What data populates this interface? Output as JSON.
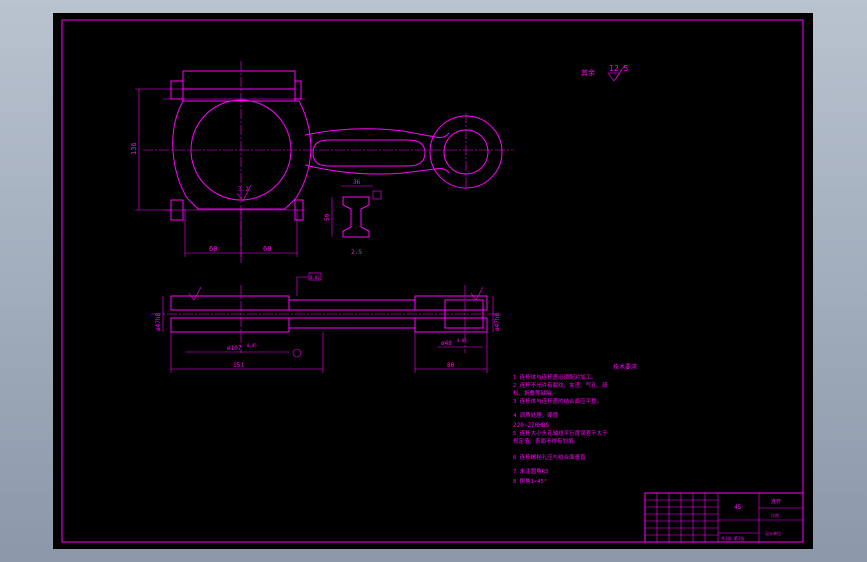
{
  "colors": {
    "line": "#ff00ff",
    "paper": "#000000",
    "background": "#a0acba"
  },
  "roughness": {
    "label": "其余",
    "value": "12.5"
  },
  "dimensions": {
    "front_height": "136",
    "front_bottom_left": "60",
    "front_bottom_right": "60",
    "big_bore_roughness": "3.2",
    "section_width": "36",
    "section_height": "50",
    "section_web": "2.5",
    "side_big_diam_left": "ø47h8",
    "side_big_diam_right": "ø47h8",
    "side_big_bore": "ø107",
    "side_big_bore_tol": "0.05",
    "side_small_bore": "ø48",
    "side_small_bore_tol": "0.05",
    "side_length_left": "151",
    "side_length_right": "80",
    "tolerance_frame": "0.02"
  },
  "requirements": {
    "title": "技术要求",
    "lines": [
      "1 连杆体与连杆盖必须配对加工。",
      "2 连杆不允许有裂纹、夹渣、气孔、疏",
      "  松、折叠等缺陷。",
      "3 连杆体与连杆盖的结合面应平整。",
      "4 调质处理，硬度",
      "220~270HBS",
      "5 连杆大小头孔轴线平行度误差不大于",
      "  规定值，表面不得有划痕。",
      "6 连杆螺栓孔应与结合面垂直",
      "7 未注圆角R3",
      "8 倒角1×45°"
    ]
  },
  "title_block": {
    "material": "45",
    "part_name": "连杆",
    "scale": "比例",
    "sheet": "共1张 第1张",
    "school": "设计单位"
  }
}
